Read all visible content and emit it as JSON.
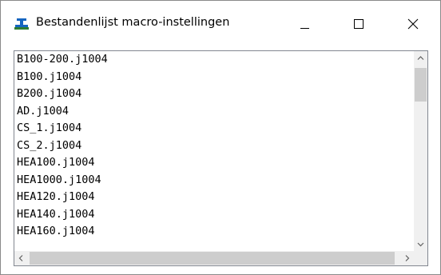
{
  "window": {
    "title": "Bestandenlijst macro-instellingen",
    "app_icon": "steel-beam-app-icon",
    "controls": {
      "minimize": "minimize-icon",
      "maximize": "maximize-icon",
      "close": "close-icon"
    }
  },
  "file_list": {
    "items": [
      "B100-200.j1004",
      "B100.j1004",
      "B200.j1004",
      "AD.j1004",
      "CS_1.j1004",
      "CS_2.j1004",
      "HEA100.j1004",
      "HEA1000.j1004",
      "HEA120.j1004",
      "HEA140.j1004",
      "HEA160.j1004"
    ],
    "vertical_scroll_position": 0.0,
    "horizontal_scroll_position": 0.0
  },
  "colors": {
    "icon_blue": "#1565c0",
    "icon_green": "#2e7d32",
    "scroll_track": "#f0f0f0",
    "scroll_thumb": "#cdcdcd",
    "list_border": "#828790"
  }
}
